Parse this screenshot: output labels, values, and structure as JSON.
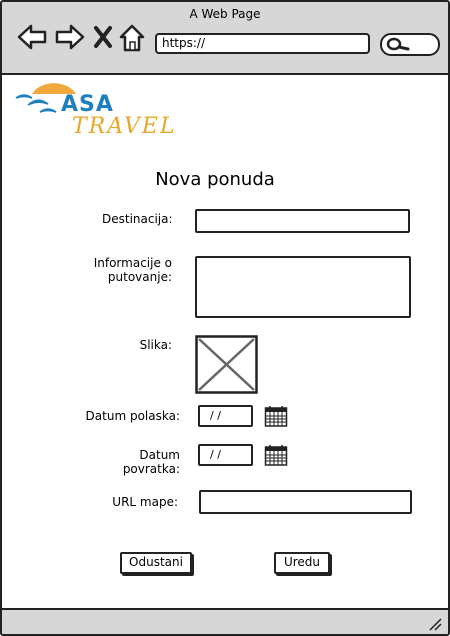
{
  "window": {
    "title": "A Web Page",
    "url": "https://"
  },
  "logo": {
    "asa": "ASA",
    "travel": "TRAVEL"
  },
  "form": {
    "title": "Nova ponuda",
    "destination_label": "Destinacija:",
    "info_label": "Informacije o putovanje:",
    "image_label": "Slika:",
    "departure_label": "Datum polaska:",
    "departure_value": "/  /",
    "return_label": "Datum povratka:",
    "return_value": "/  /",
    "map_url_label": "URL mape:",
    "cancel_label": "Odustani",
    "ok_label": "Uredu"
  }
}
